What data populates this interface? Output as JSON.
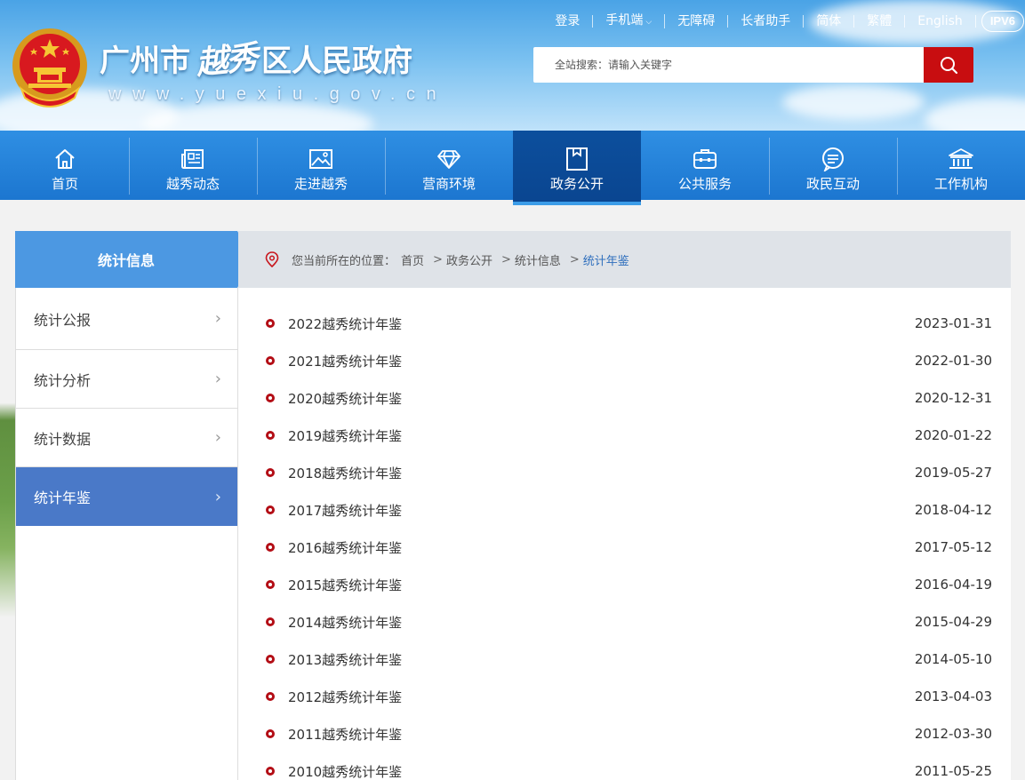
{
  "header": {
    "site_name_part1": "广州市",
    "site_name_part2": "越秀",
    "site_name_part3": "区人民政府",
    "domain": "www.yuexiu.gov.cn",
    "toplinks": [
      {
        "label": "登录"
      },
      {
        "label": "手机端"
      },
      {
        "label": "无障碍"
      },
      {
        "label": "长者助手"
      },
      {
        "label": "简体"
      },
      {
        "label": "繁體"
      },
      {
        "label": "English"
      }
    ],
    "ipv6": "IPV6",
    "search_placeholder": "全站搜索：请输入关键字"
  },
  "nav": [
    {
      "label": "首页",
      "icon": "home-icon"
    },
    {
      "label": "越秀动态",
      "icon": "newspaper-icon"
    },
    {
      "label": "走进越秀",
      "icon": "picture-icon"
    },
    {
      "label": "营商环境",
      "icon": "diamond-icon"
    },
    {
      "label": "政务公开",
      "icon": "document-icon",
      "active": true
    },
    {
      "label": "公共服务",
      "icon": "briefcase-icon"
    },
    {
      "label": "政民互动",
      "icon": "chat-icon"
    },
    {
      "label": "工作机构",
      "icon": "building-icon"
    }
  ],
  "sidebar": {
    "title": "统计信息",
    "items": [
      {
        "label": "统计公报"
      },
      {
        "label": "统计分析"
      },
      {
        "label": "统计数据"
      },
      {
        "label": "统计年鉴",
        "active": true
      }
    ]
  },
  "breadcrumb": {
    "prefix": "您当前所在的位置：",
    "items": [
      "首页",
      "政务公开",
      "统计信息",
      "统计年鉴"
    ]
  },
  "list": [
    {
      "title": "2022越秀统计年鉴",
      "date": "2023-01-31"
    },
    {
      "title": "2021越秀统计年鉴",
      "date": "2022-01-30"
    },
    {
      "title": "2020越秀统计年鉴",
      "date": "2020-12-31"
    },
    {
      "title": "2019越秀统计年鉴",
      "date": "2020-01-22"
    },
    {
      "title": "2018越秀统计年鉴",
      "date": "2019-05-27"
    },
    {
      "title": "2017越秀统计年鉴",
      "date": "2018-04-12"
    },
    {
      "title": "2016越秀统计年鉴",
      "date": "2017-05-12"
    },
    {
      "title": "2015越秀统计年鉴",
      "date": "2016-04-19"
    },
    {
      "title": "2014越秀统计年鉴",
      "date": "2015-04-29"
    },
    {
      "title": "2013越秀统计年鉴",
      "date": "2014-05-10"
    },
    {
      "title": "2012越秀统计年鉴",
      "date": "2013-04-03"
    },
    {
      "title": "2011越秀统计年鉴",
      "date": "2012-03-30"
    },
    {
      "title": "2010越秀统计年鉴",
      "date": "2011-05-25"
    }
  ],
  "colors": {
    "nav_blue": "#1c76d0",
    "nav_active": "#0c4f9d",
    "search_red": "#c80d10",
    "side_active": "#4a79c8",
    "bullet_red": "#b30d15"
  }
}
